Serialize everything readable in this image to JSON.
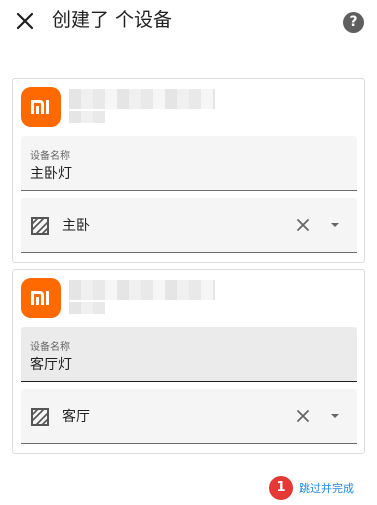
{
  "header": {
    "title": "创建了 个设备",
    "close_icon": "close-icon",
    "help_icon": "help-icon",
    "help_symbol": "?"
  },
  "devices": [
    {
      "name_field_label": "设备名称",
      "name_field_value": "主卧灯",
      "area_value": "主卧",
      "area_icon": "area-hatch-icon"
    },
    {
      "name_field_label": "设备名称",
      "name_field_value": "客厅灯",
      "area_value": "客厅",
      "area_icon": "area-hatch-icon"
    }
  ],
  "footer": {
    "badge_count": "1",
    "skip_label": "跳过并完成"
  },
  "colors": {
    "brand_orange": "#ff6900",
    "link_blue": "#1e88e5",
    "badge_red": "#e53935"
  }
}
